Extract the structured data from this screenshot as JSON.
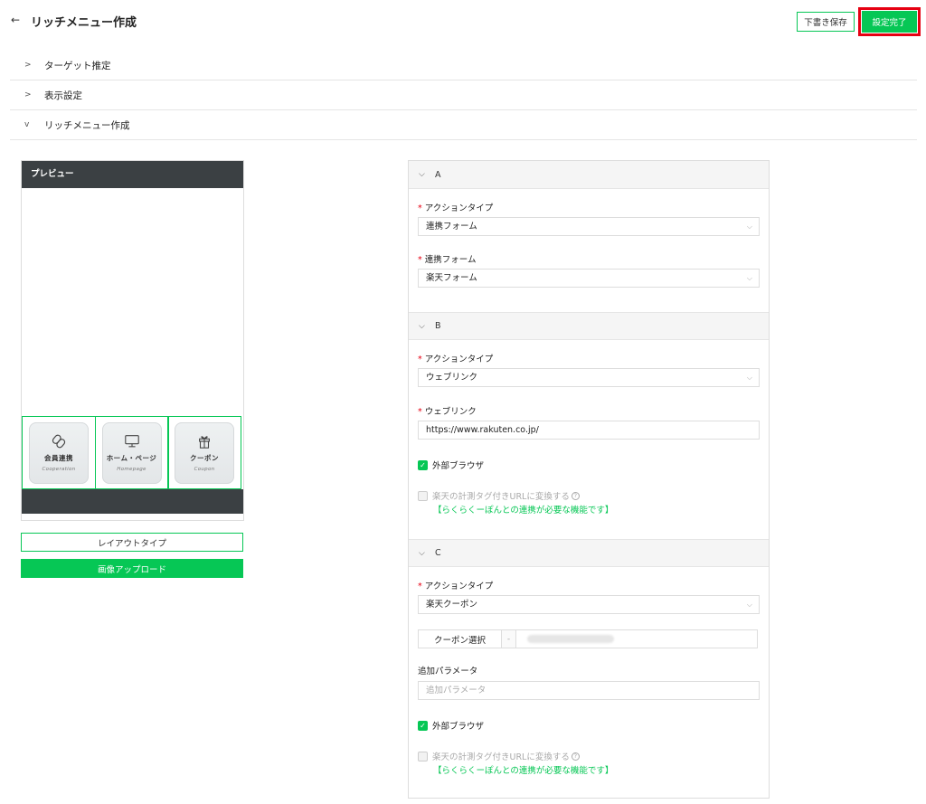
{
  "header": {
    "title": "リッチメニュー作成",
    "back_icon": "←",
    "draft_label": "下書き保存",
    "done_label": "設定完了",
    "accent": "#06c755",
    "highlight": "#e60012"
  },
  "accordions": [
    {
      "label": "ターゲット推定",
      "state": "collapsed",
      "chevron": ">"
    },
    {
      "label": "表示設定",
      "state": "collapsed",
      "chevron": ">"
    },
    {
      "label": "リッチメニュー作成",
      "state": "expanded",
      "chevron": "v"
    }
  ],
  "preview": {
    "header": "プレビュー",
    "cells": [
      {
        "jp": "会員連携",
        "en": "Cooperation",
        "icon": "link-icon"
      },
      {
        "jp": "ホーム・ページ",
        "en": "Homepage",
        "icon": "monitor-icon"
      },
      {
        "jp": "クーポン",
        "en": "Coupon",
        "icon": "gift-icon"
      }
    ],
    "layout_button": "レイアウトタイプ",
    "upload_button": "画像アップロード"
  },
  "actions": {
    "a": {
      "label": "A",
      "type_label": "アクションタイプ",
      "type_value": "連携フォーム",
      "form_label": "連携フォーム",
      "form_value": "楽天フォーム"
    },
    "b": {
      "label": "B",
      "type_label": "アクションタイプ",
      "type_value": "ウェブリンク",
      "link_label": "ウェブリンク",
      "link_value": "https://www.rakuten.co.jp/",
      "browser_label": "外部ブラウザ",
      "tag_label": "楽天の計測タグ付きURLに変換する",
      "tag_note": "【らくらくーぽんとの連携が必要な機能です】"
    },
    "c": {
      "label": "C",
      "type_label": "アクションタイプ",
      "type_value": "楽天クーポン",
      "coupon_button": "クーポン選択",
      "coupon_dash": "-",
      "param_label": "追加パラメータ",
      "param_placeholder": "追加パラメータ",
      "browser_label": "外部ブラウザ",
      "tag_label": "楽天の計測タグ付きURLに変換する",
      "tag_note": "【らくらくーぽんとの連携が必要な機能です】"
    }
  },
  "icons": {
    "chevron_down": "⌵",
    "check": "✓",
    "help": "?"
  }
}
